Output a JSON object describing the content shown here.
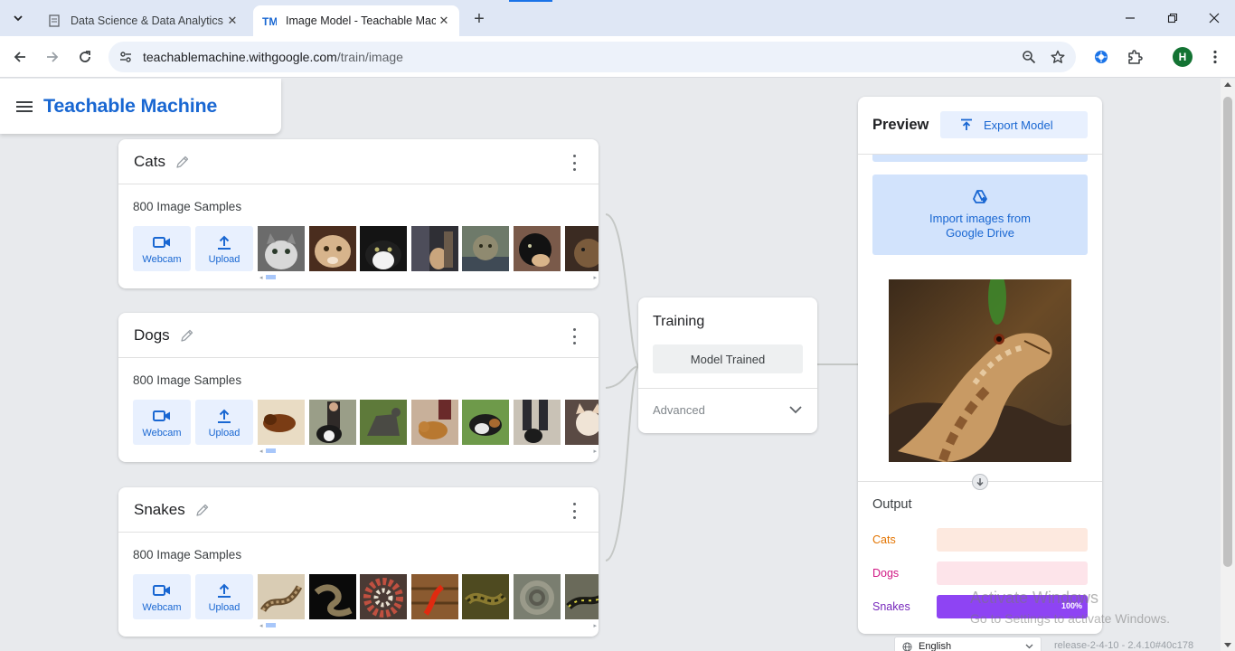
{
  "browser": {
    "tabs": [
      {
        "title": "Data Science & Data Analytics B",
        "active": false,
        "favicon": "tab-favicon-doc"
      },
      {
        "title": "Image Model - Teachable Mach",
        "active": true,
        "favicon": "tm-favicon"
      }
    ],
    "url_host": "teachablemachine.withgoogle.com",
    "url_path": "/train/image",
    "profile_initial": "H"
  },
  "app": {
    "brand": "Teachable Machine"
  },
  "classes": [
    {
      "name": "Cats",
      "samples": "800 Image Samples",
      "webcam_label": "Webcam",
      "upload_label": "Upload"
    },
    {
      "name": "Dogs",
      "samples": "800 Image Samples",
      "webcam_label": "Webcam",
      "upload_label": "Upload"
    },
    {
      "name": "Snakes",
      "samples": "800 Image Samples",
      "webcam_label": "Webcam",
      "upload_label": "Upload"
    }
  ],
  "training": {
    "title": "Training",
    "button": "Model Trained",
    "advanced": "Advanced"
  },
  "preview": {
    "title": "Preview",
    "export_label": "Export Model",
    "drive_label_1": "Import images from",
    "drive_label_2": "Google Drive",
    "output_title": "Output",
    "outputs": [
      {
        "label": "Cats",
        "color": "#e37400",
        "bar_bg": "#fde9df",
        "fill": "#f9ab7d",
        "value": 0,
        "pct": ""
      },
      {
        "label": "Dogs",
        "color": "#d01884",
        "bar_bg": "#fde4ea",
        "fill": "#f4879f",
        "value": 0,
        "pct": ""
      },
      {
        "label": "Snakes",
        "color": "#7627bb",
        "bar_bg": "#e9d5ff",
        "fill": "#8e44f3",
        "value": 1.0,
        "pct": "100%"
      }
    ]
  },
  "footer": {
    "language": "English",
    "release": "release-2-4-10 - 2.4.10#40c178"
  },
  "watermark": {
    "line1": "Activate Windows",
    "line2": "Go to Settings to activate Windows."
  },
  "colors": {
    "brand": "#1967d2",
    "chip_bg": "#e8f0fe"
  }
}
